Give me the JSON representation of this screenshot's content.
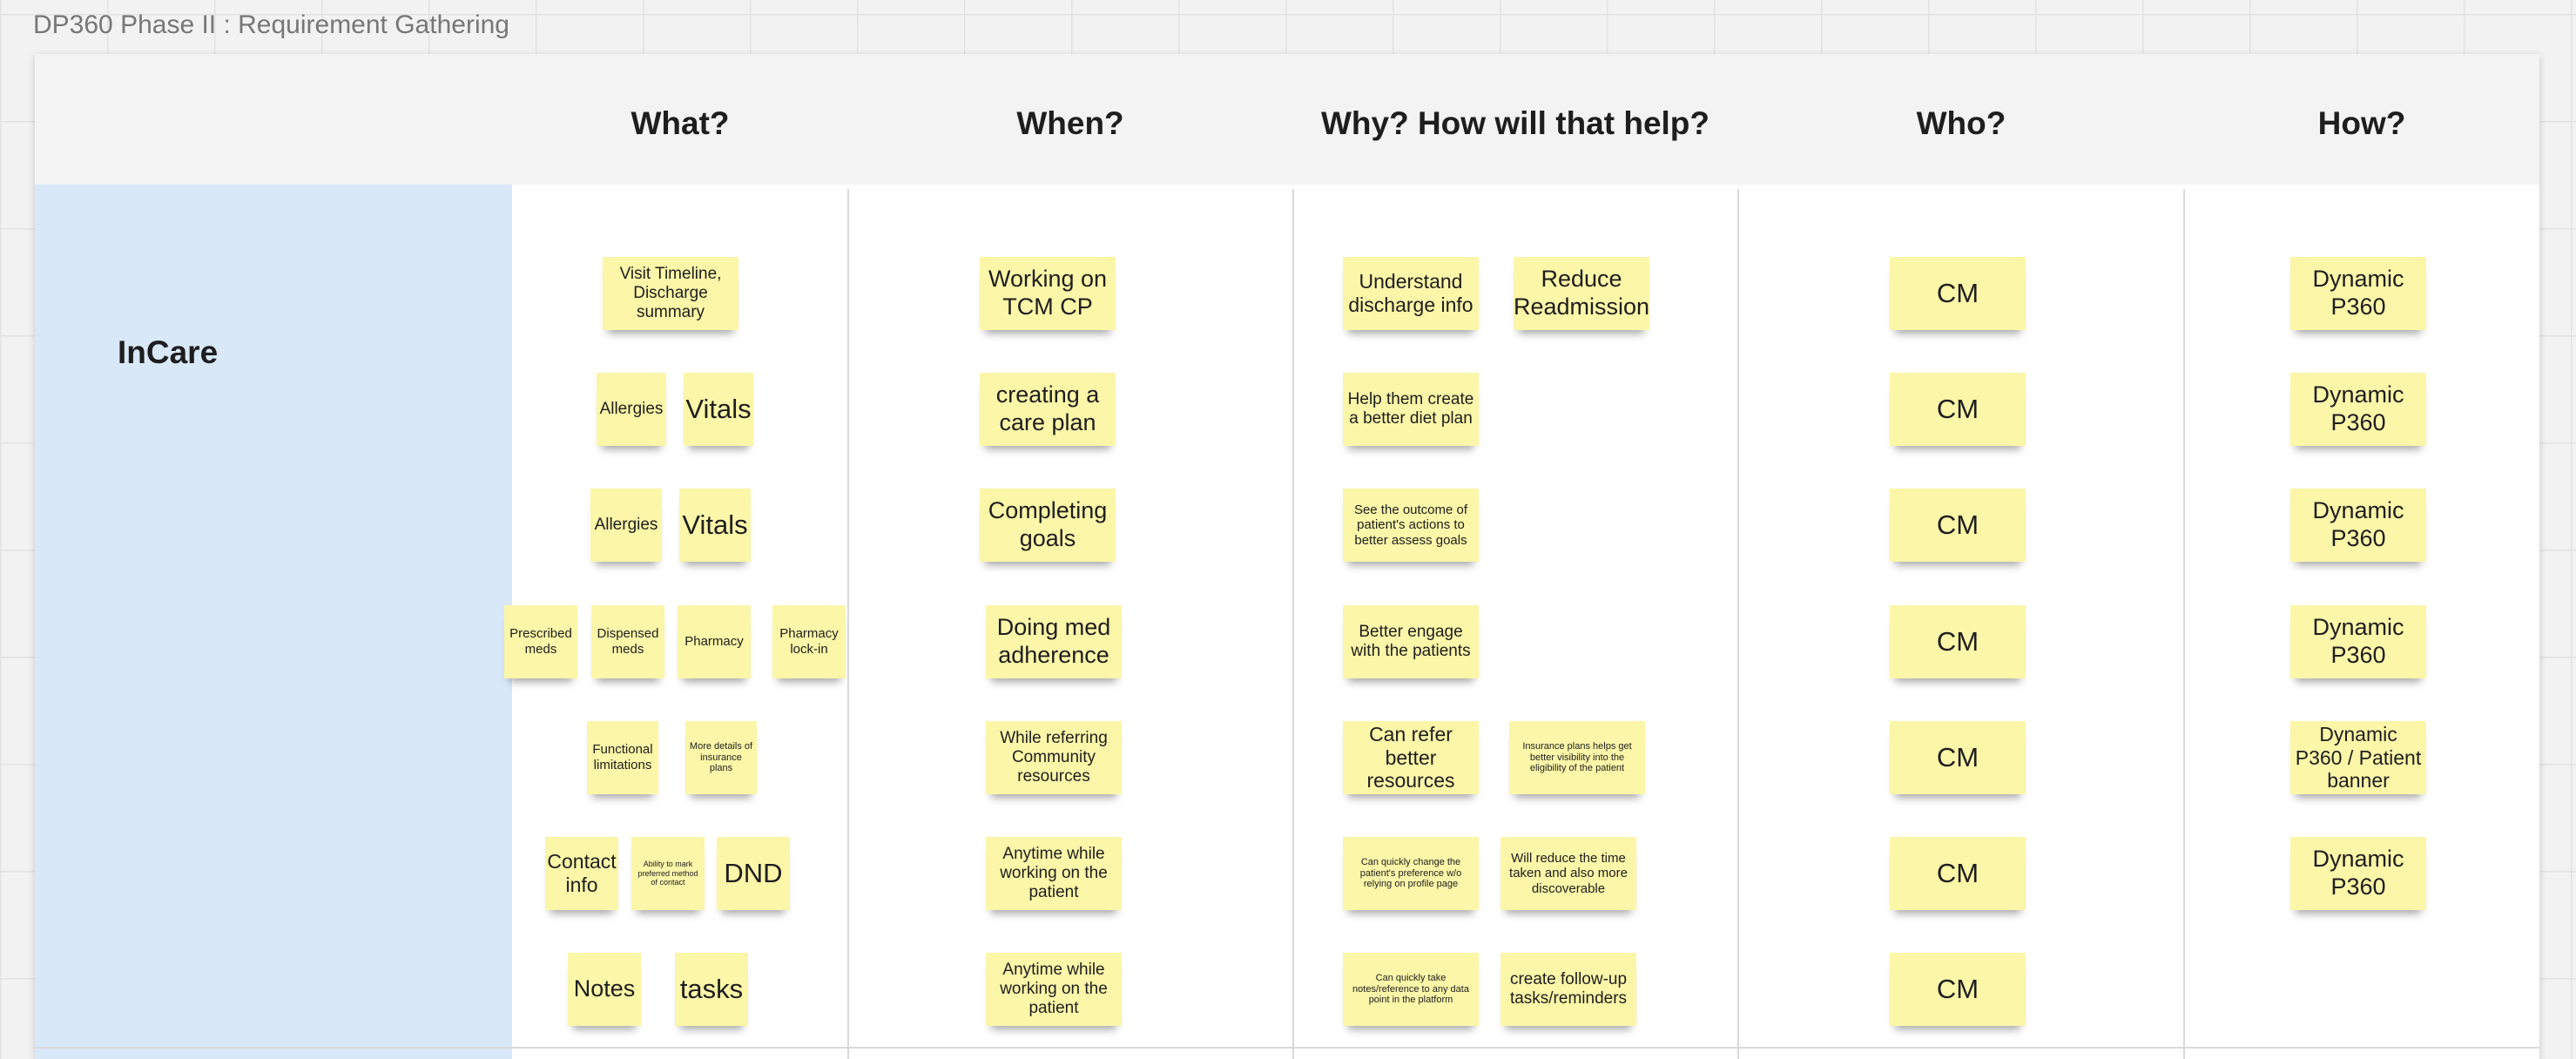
{
  "board_title": "DP360 Phase II : Requirement Gathering",
  "columns": [
    "What?",
    "When?",
    "Why? How will that help?",
    "Who?",
    "How?"
  ],
  "row_label": "InCare",
  "rows": [
    {
      "what": [
        "Visit Timeline, Discharge summary"
      ],
      "when": "Working on TCM CP",
      "why": [
        "Understand discharge info",
        "Reduce Readmission"
      ],
      "who": "CM",
      "how": "Dynamic P360"
    },
    {
      "what": [
        "Allergies",
        "Vitals"
      ],
      "when": "creating a care plan",
      "why": [
        "Help them create a better diet plan"
      ],
      "who": "CM",
      "how": "Dynamic P360"
    },
    {
      "what": [
        "Allergies",
        "Vitals"
      ],
      "when": "Completing goals",
      "why": [
        "See the outcome of patient's actions to better assess goals"
      ],
      "who": "CM",
      "how": "Dynamic P360"
    },
    {
      "what": [
        "Prescribed meds",
        "Dispensed meds",
        "Pharmacy",
        "Pharmacy lock-in"
      ],
      "when": "Doing med adherence",
      "why": [
        "Better engage with the patients"
      ],
      "who": "CM",
      "how": "Dynamic P360"
    },
    {
      "what": [
        "Functional limitations",
        "More details of insurance plans"
      ],
      "when": "While referring Community resources",
      "why": [
        "Can refer better resources",
        "Insurance plans helps get better visibility into the eligibility of the patient"
      ],
      "who": "CM",
      "how": "Dynamic P360 / Patient banner"
    },
    {
      "what": [
        "Contact info",
        "Ability to mark preferred method of contact",
        "DND"
      ],
      "when": "Anytime while working on the patient",
      "why": [
        "Can quickly change the patient's preference w/o relying on profile page",
        "Will reduce the time taken and also more discoverable"
      ],
      "who": "CM",
      "how": "Dynamic P360"
    },
    {
      "what": [
        "Notes",
        "tasks"
      ],
      "when": "Anytime while working on the patient",
      "why": [
        "Can quickly take notes/reference to any data point in the platform",
        "create follow-up tasks/reminders"
      ],
      "who": "CM"
    }
  ]
}
